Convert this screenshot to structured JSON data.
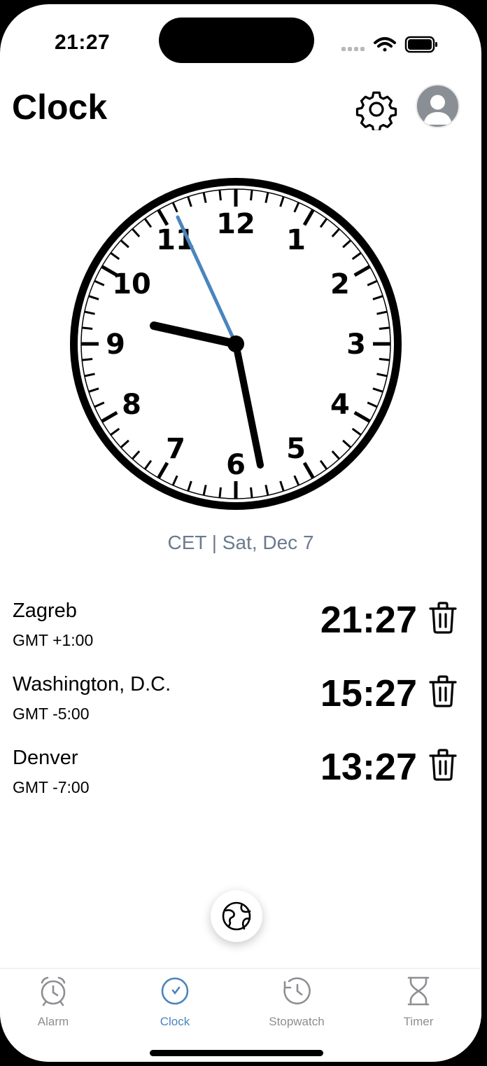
{
  "status_bar": {
    "time": "21:27"
  },
  "header": {
    "title": "Clock"
  },
  "clock": {
    "timezone_date": "CET | Sat, Dec 7",
    "numerals": [
      "12",
      "1",
      "2",
      "3",
      "4",
      "5",
      "6",
      "7",
      "8",
      "9",
      "10",
      "11"
    ],
    "hour_hand_color": "#000000",
    "second_hand_color": "#4a85bd"
  },
  "cities": [
    {
      "name": "Zagreb",
      "offset": "GMT +1:00",
      "time": "21:27"
    },
    {
      "name": "Washington, D.C.",
      "offset": "GMT -5:00",
      "time": "15:27"
    },
    {
      "name": "Denver",
      "offset": "GMT -7:00",
      "time": "13:27"
    }
  ],
  "fab": {
    "icon": "globe-icon"
  },
  "tabs": [
    {
      "label": "Alarm",
      "icon": "alarm-icon",
      "active": false
    },
    {
      "label": "Clock",
      "icon": "clock-icon",
      "active": true
    },
    {
      "label": "Stopwatch",
      "icon": "stopwatch-icon",
      "active": false
    },
    {
      "label": "Timer",
      "icon": "hourglass-icon",
      "active": false
    }
  ],
  "colors": {
    "accent": "#4a85bd",
    "inactive": "#8e8e93",
    "tz_text": "#6b7a8d"
  }
}
